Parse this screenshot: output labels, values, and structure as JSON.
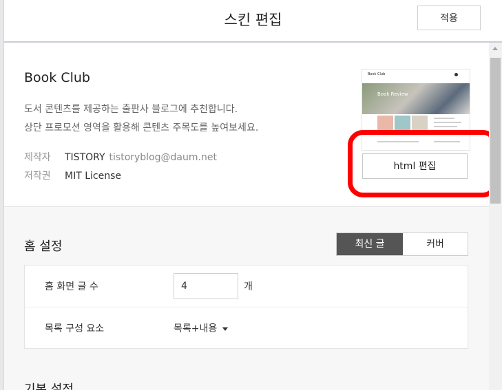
{
  "header": {
    "title": "스킨 편집",
    "apply_label": "적용"
  },
  "skin": {
    "name": "Book Club",
    "description_line1": "도서 콘텐츠를 제공하는 출판사 블로그에 추천합니다.",
    "description_line2": "상단 프로모션 영역을 활용해 콘텐츠 주목도를 높여보세요.",
    "maker_label": "제작자",
    "maker_name": "TISTORY",
    "maker_email": "tistoryblog@daum.net",
    "license_label": "저작권",
    "license_value": "MIT License",
    "preview": {
      "brand": "Book Club",
      "hero_text": "Book Review"
    },
    "edit_html_label": "html 편집"
  },
  "annotation": {
    "color": "#ff0000"
  },
  "home": {
    "title": "홈 설정",
    "toggle": {
      "options": [
        "최신 글",
        "커버"
      ],
      "selected": "최신 글"
    },
    "post_count_label": "홈 화면 글 수",
    "post_count_value": "4",
    "post_count_unit": "개",
    "list_component_label": "목록 구성 요소",
    "list_component_value": "목록+내용"
  },
  "basic": {
    "title": "기본 설정"
  },
  "colors": {
    "accent_dark": "#555555",
    "border": "#cfcfcf",
    "background": "#f7f7f7"
  }
}
